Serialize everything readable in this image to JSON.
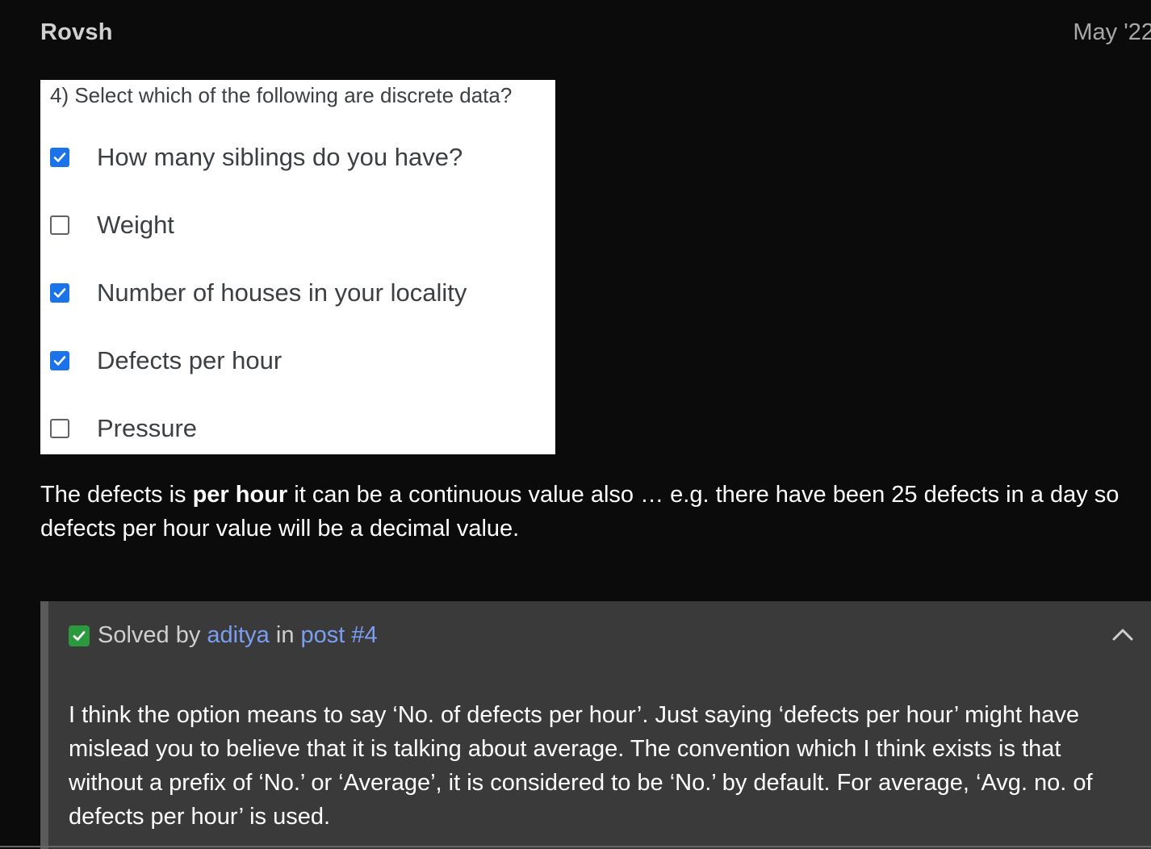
{
  "post": {
    "author": "Rovsh",
    "date": "May '22"
  },
  "quiz": {
    "question": "4) Select which of the following are discrete data?",
    "options": [
      {
        "label": "How many siblings do you have?",
        "checked": true
      },
      {
        "label": "Weight",
        "checked": false
      },
      {
        "label": "Number of houses in your locality",
        "checked": true
      },
      {
        "label": "Defects per hour",
        "checked": true
      },
      {
        "label": "Pressure",
        "checked": false
      }
    ]
  },
  "body": {
    "prefix": "The defects is ",
    "bold": "per hour",
    "suffix": " it can be a continuous value also … e.g. there have been 25 defects in a day so defects per hour value will be a decimal value."
  },
  "solution": {
    "solved_by_label": "Solved by",
    "solver": "aditya",
    "in_label": "in",
    "post_link": "post #4",
    "text": "I think the option means to say ‘No. of defects per hour’. Just saying ‘defects per hour’ might have mislead you to believe that it is talking about average. The convention which I think exists is that without a prefix of ‘No.’ or ‘Average’, it is considered to be ‘No.’ by default. For average, ‘Avg. no. of defects per hour’ is used."
  },
  "colors": {
    "checkbox_checked": "#1a73e8",
    "solved_green": "#2b9a3e",
    "link_blue": "#7b9ef0"
  },
  "icons": {
    "solved": "check-square-icon",
    "collapse": "chevron-up-icon",
    "checkbox": "checkbox-icon"
  }
}
